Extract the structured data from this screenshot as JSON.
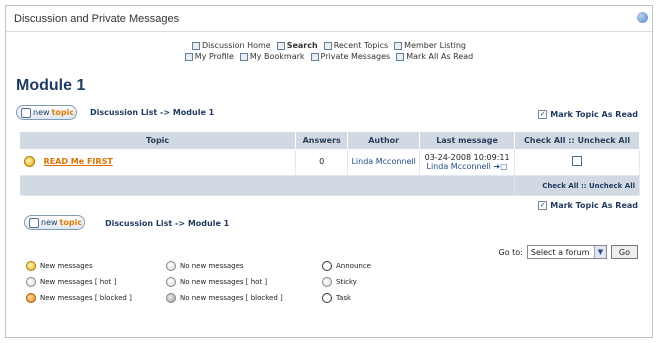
{
  "panel": {
    "title": "Discussion and Private Messages"
  },
  "toplinks": {
    "row1": [
      "Discussion Home",
      "Search",
      "Recent Topics",
      "Member Listing"
    ],
    "row2": [
      "My Profile",
      "My Bookmark",
      "Private Messages",
      "Mark All As Read"
    ]
  },
  "module": {
    "title": "Module 1"
  },
  "newtopic": {
    "prefix": "new",
    "bold": "topic"
  },
  "breadcrumb": "Discussion List -> Module 1",
  "mark_topic_read": "Mark Topic As Read",
  "table": {
    "headers": [
      "Topic",
      "Answers",
      "Author",
      "Last message",
      "Check All :: Uncheck All"
    ],
    "rows": [
      {
        "topic": "READ Me FIRST",
        "answers": "0",
        "author": "Linda Mcconnell",
        "last_date": "03-24-2008 10:09:11",
        "last_author": "Linda Mcconnell"
      }
    ],
    "footer_check": "Check All :: Uncheck All"
  },
  "goto": {
    "label": "Go to:",
    "selected": "Select a forum",
    "button": "Go"
  },
  "legend": [
    {
      "label": "New messages",
      "icon": "new-messages-icon"
    },
    {
      "label": "No new messages",
      "icon": "no-new-messages-icon"
    },
    {
      "label": "Announce",
      "icon": "announce-icon"
    },
    {
      "label": "New messages [ hot ]",
      "icon": "new-messages-hot-icon"
    },
    {
      "label": "No new messages [ hot ]",
      "icon": "no-new-messages-hot-icon"
    },
    {
      "label": "Sticky",
      "icon": "sticky-icon"
    },
    {
      "label": "New messages [ blocked ]",
      "icon": "new-messages-blocked-icon"
    },
    {
      "label": "No new messages [ blocked ]",
      "icon": "no-new-messages-blocked-icon"
    },
    {
      "label": "Task",
      "icon": "task-icon"
    }
  ]
}
